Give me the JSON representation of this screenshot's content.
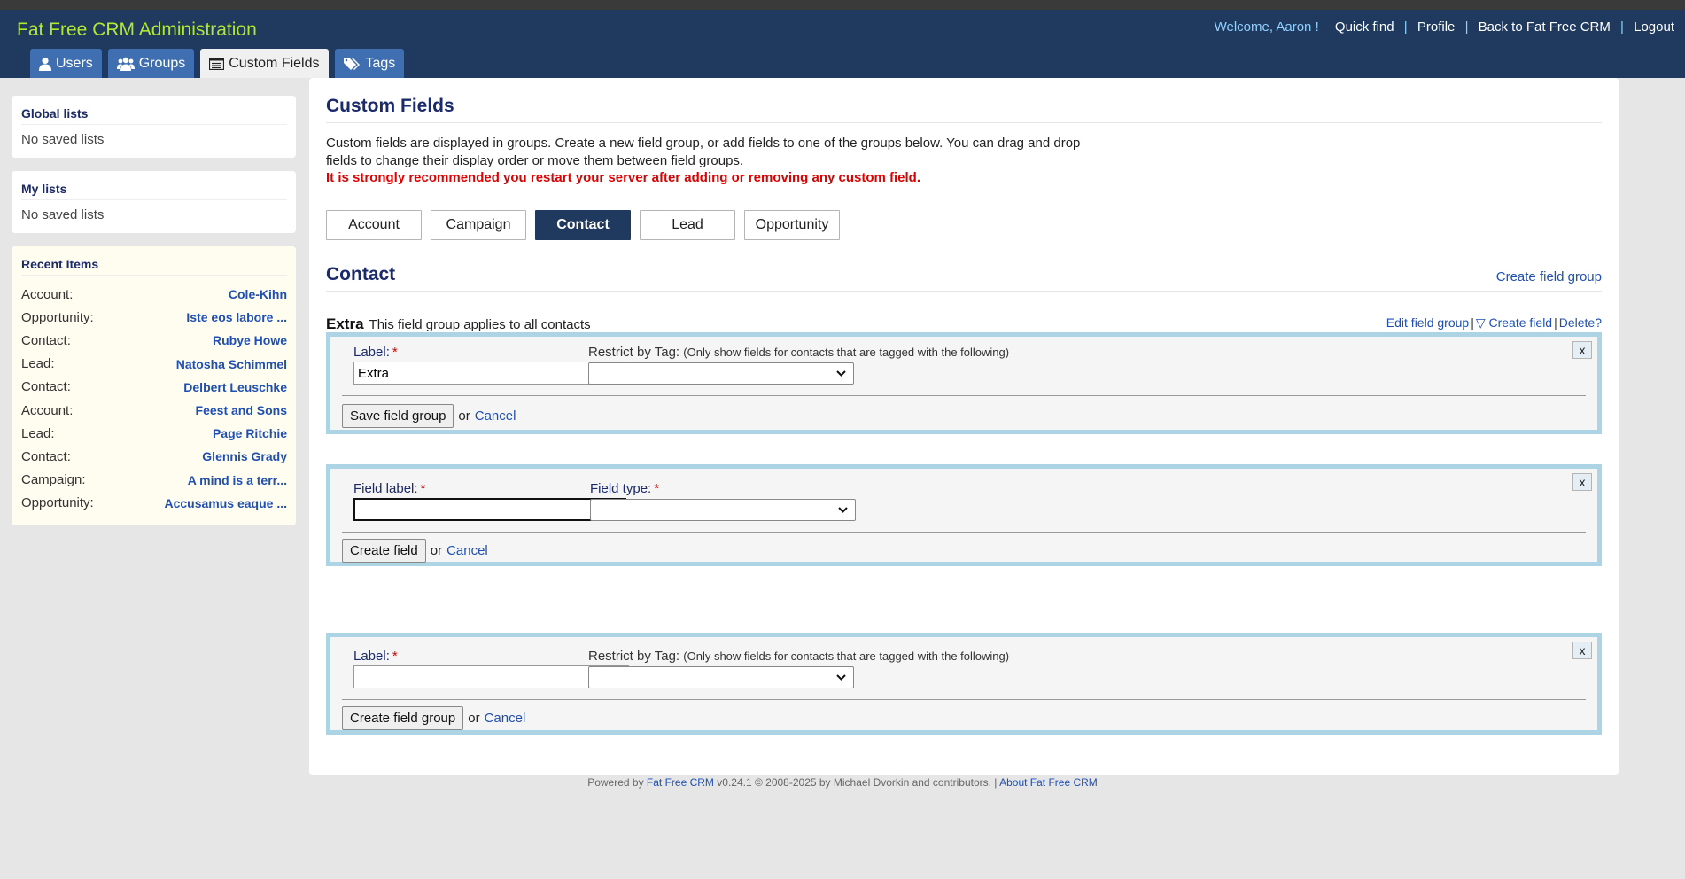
{
  "app": {
    "title": "Fat Free CRM Administration"
  },
  "topnav": {
    "welcome": "Welcome, Aaron !",
    "links": [
      "Quick find",
      "Profile",
      "Back to Fat Free CRM",
      "Logout"
    ]
  },
  "tabs": [
    {
      "label": "Users",
      "icon": "user-icon"
    },
    {
      "label": "Groups",
      "icon": "users-group-icon"
    },
    {
      "label": "Custom Fields",
      "icon": "list-icon",
      "active": true
    },
    {
      "label": "Tags",
      "icon": "tags-icon"
    }
  ],
  "sidebar": {
    "global": {
      "title": "Global lists",
      "empty": "No saved lists"
    },
    "my": {
      "title": "My lists",
      "empty": "No saved lists"
    },
    "recent": {
      "title": "Recent Items",
      "items": [
        {
          "kind": "Account:",
          "name": "Cole-Kihn"
        },
        {
          "kind": "Opportunity:",
          "name": "Iste eos labore ..."
        },
        {
          "kind": "Contact:",
          "name": "Rubye Howe"
        },
        {
          "kind": "Lead:",
          "name": "Natosha Schimmel"
        },
        {
          "kind": "Contact:",
          "name": "Delbert Leuschke"
        },
        {
          "kind": "Account:",
          "name": "Feest and Sons"
        },
        {
          "kind": "Lead:",
          "name": "Page Ritchie"
        },
        {
          "kind": "Contact:",
          "name": "Glennis Grady"
        },
        {
          "kind": "Campaign:",
          "name": "A mind is a terr..."
        },
        {
          "kind": "Opportunity:",
          "name": "Accusamus eaque ..."
        }
      ]
    }
  },
  "main": {
    "title": "Custom Fields",
    "intro": "Custom fields are displayed in groups. Create a new field group, or add fields to one of the groups below. You can drag and drop fields to change their display order or move them between field groups.",
    "warning": "It is strongly recommended you restart your server after adding or removing any custom field.",
    "types": [
      "Account",
      "Campaign",
      "Contact",
      "Lead",
      "Opportunity"
    ],
    "active_type": "Contact",
    "section_title": "Contact",
    "create_group_link": "Create field group",
    "group": {
      "name": "Extra",
      "description": "This field group applies to all contacts",
      "actions": [
        "Edit field group",
        "▽ Create field",
        "Delete?"
      ]
    },
    "edit_group_form": {
      "label": "Label:",
      "label_value": "Extra",
      "tag_label": "Restrict by Tag:",
      "tag_hint": "(Only show fields for contacts that are tagged with the following)",
      "submit": "Save field group",
      "or": "or",
      "cancel": "Cancel",
      "close": "x"
    },
    "create_field_form": {
      "field_label": "Field label:",
      "field_type": "Field type:",
      "submit": "Create field",
      "or": "or",
      "cancel": "Cancel",
      "close": "x"
    },
    "new_group_form": {
      "label": "Label:",
      "label_value": "",
      "tag_label": "Restrict by Tag:",
      "tag_hint": "(Only show fields for contacts that are tagged with the following)",
      "submit": "Create field group",
      "or": "or",
      "cancel": "Cancel",
      "close": "x"
    }
  },
  "footer": {
    "powered": "Powered by",
    "product": "Fat Free CRM",
    "rest": "v0.24.1 © 2008-2025 by Michael Dvorkin and contributors. |",
    "about": "About Fat Free CRM"
  },
  "colors": {
    "header_bg": "#1f3a5e",
    "title_green": "#b2e832",
    "tab_blue": "#3f6fb0",
    "link_blue": "#1f4fb4",
    "warning_red": "#e00000",
    "panel_border": "#acd4e4"
  }
}
